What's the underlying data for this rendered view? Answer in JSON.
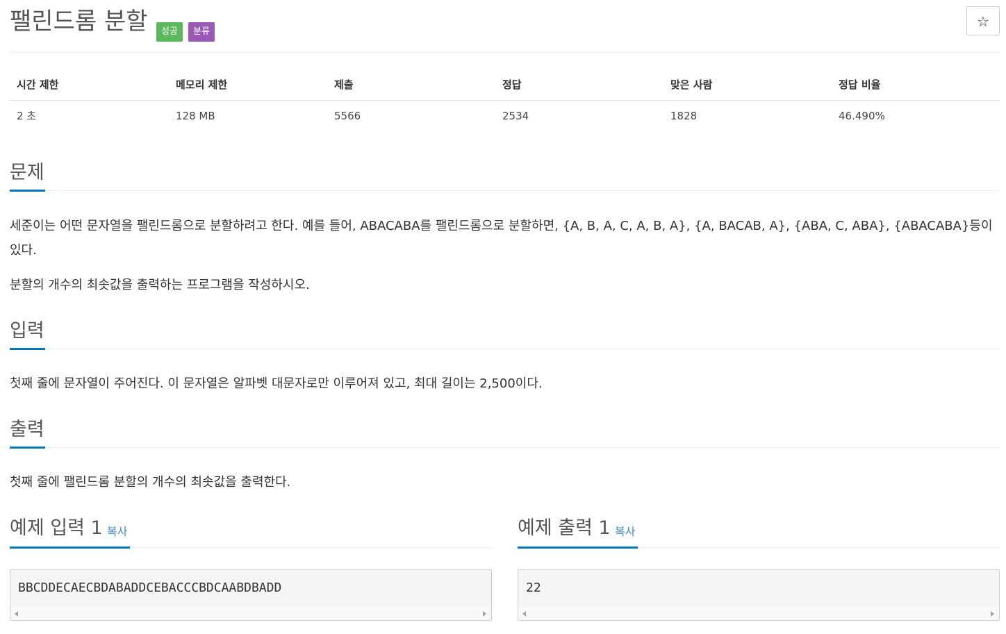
{
  "problem": {
    "title": "팰린드롬 분할",
    "labels": [
      "성공",
      "분류"
    ],
    "star_icon": "☆"
  },
  "stats": {
    "headers": [
      "시간 제한",
      "메모리 제한",
      "제출",
      "정답",
      "맞은 사람",
      "정답 비율"
    ],
    "values": [
      "2 초",
      "128 MB",
      "5566",
      "2534",
      "1828",
      "46.490%"
    ]
  },
  "sections": {
    "description": {
      "heading": "문제",
      "paragraphs": [
        "세준이는 어떤 문자열을 팰린드롬으로 분할하려고 한다. 예를 들어, ABACABA를 팰린드롬으로 분할하면, {A, B, A, C, A, B, A}, {A, BACAB, A}, {ABA, C, ABA}, {ABACABA}등이 있다.",
        "분할의 개수의 최솟값을 출력하는 프로그램을 작성하시오."
      ]
    },
    "input": {
      "heading": "입력",
      "paragraphs": [
        "첫째 줄에 문자열이 주어진다. 이 문자열은 알파벳 대문자로만 이루어져 있고, 최대 길이는 2,500이다."
      ]
    },
    "output": {
      "heading": "출력",
      "paragraphs": [
        "첫째 줄에 팰린드롬 분할의 개수의 최솟값을 출력한다."
      ]
    }
  },
  "samples": {
    "input": {
      "heading": "예제 입력 1",
      "copy_label": "복사",
      "content": "BBCDDECAECBDABADDCEBACCCBDCAABDBADD"
    },
    "output": {
      "heading": "예제 출력 1",
      "copy_label": "복사",
      "content": "22"
    }
  },
  "colors": {
    "success": "#5cb85c",
    "category": "#9b59b6",
    "accent": "#0076c0",
    "link": "#428bca"
  }
}
